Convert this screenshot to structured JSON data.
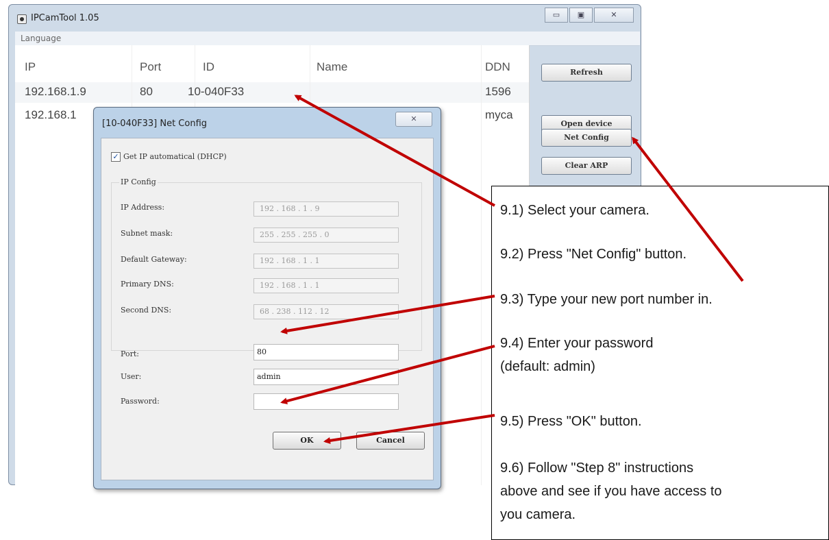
{
  "window": {
    "title": "IPCamTool 1.05",
    "menu": "Language",
    "controls": {
      "minimize": "▭",
      "maximize": "▣",
      "close": "✕"
    }
  },
  "device_list": {
    "headers": [
      "IP",
      "Port",
      "ID",
      "Name",
      "DDN"
    ],
    "rows": [
      [
        "192.168.1.9",
        "80",
        "10-040F33",
        "",
        "1596"
      ],
      [
        "192.168.1",
        "",
        "",
        "",
        "myca"
      ]
    ]
  },
  "side_buttons": [
    "Refresh",
    "Open device",
    "Net Config",
    "Clear ARP"
  ],
  "dialog": {
    "title": "[10-040F33] Net Config",
    "close": "✕",
    "dhcp_label": "Get IP automatical (DHCP)",
    "dhcp_checked": true,
    "group_title": "IP Config",
    "fields": [
      {
        "label": "IP Address:",
        "value": "192 . 168 .  1  .  9"
      },
      {
        "label": "Subnet mask:",
        "value": "255 . 255 . 255 .  0"
      },
      {
        "label": "Default Gateway:",
        "value": "192 . 168 .  1  .  1"
      },
      {
        "label": "Primary DNS:",
        "value": "192 . 168 .  1  .  1"
      },
      {
        "label": "Second DNS:",
        "value": "68 . 238 . 112 . 12"
      }
    ],
    "port_label": "Port:",
    "port_value": "80",
    "user_label": "User:",
    "user_value": "admin",
    "password_label": "Password:",
    "password_value": "",
    "ok": "OK",
    "cancel": "Cancel"
  },
  "instructions": [
    "9.1) Select your camera.",
    "9.2) Press \"Net Config\" button.",
    "9.3) Type your new port number in.",
    "9.4) Enter your password (default: admin)",
    "9.5) Press \"OK\" button.",
    "9.6) Follow \"Step 8\" instructions above and see if you have access to you camera."
  ],
  "colors": {
    "arrow": "#c00000",
    "window_frame": "#cfdbe8",
    "dialog_frame": "#bcd2e8"
  }
}
